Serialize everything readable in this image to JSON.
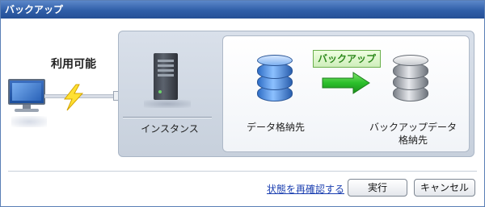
{
  "window": {
    "title": "バックアップ"
  },
  "connection": {
    "status_label": "利用可能"
  },
  "diagram": {
    "instance_label": "インスタンス",
    "data_store_label": "データ格納先",
    "backup_tag": "バックアップ",
    "backup_store_label_line1": "バックアップデータ",
    "backup_store_label_line2": "格納先"
  },
  "footer": {
    "recheck_link": "状態を再確認する",
    "run_label": "実行",
    "cancel_label": "キャンセル"
  },
  "colors": {
    "titlebar": "#2f5ea8",
    "accent_green": "#2f8a1e",
    "link": "#1b3fb0"
  },
  "icons": [
    "monitor-icon",
    "lightning-icon",
    "server-icon",
    "database-icon",
    "arrow-right-icon"
  ]
}
